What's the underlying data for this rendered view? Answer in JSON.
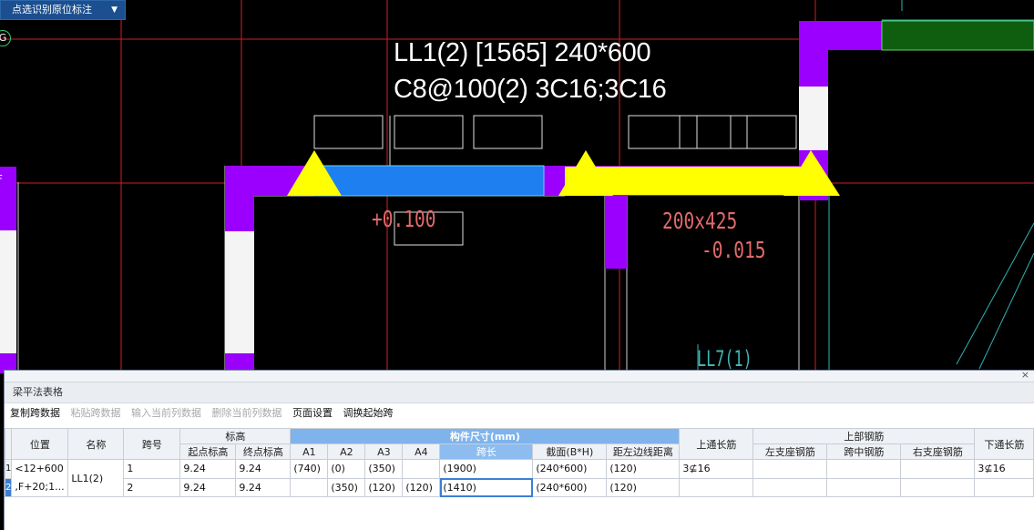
{
  "mode_dropdown": {
    "label": "点选识别原位标注",
    "arrow": "▼"
  },
  "markers": {
    "g": "G",
    "f": "F"
  },
  "beam_label": {
    "line1": "LL1(2) [1565] 240*600",
    "line2": "C8@100(2) 3C16;3C16"
  },
  "cad_texts": {
    "elevation": "+0.100",
    "section": "200x425",
    "offset": "-0.015",
    "beam_ref": "LL7(1)"
  },
  "colors": {
    "column": "#9b00ff",
    "beam_selected": "#1e7ff0",
    "highlight": "#ffff00",
    "grid_line": "#d01f1f",
    "teal_line": "#2fb3b3"
  },
  "panel": {
    "title": "梁平法表格",
    "close": "×",
    "toolbar": [
      {
        "label": "复制跨数据",
        "enabled": true
      },
      {
        "label": "粘贴跨数据",
        "enabled": false
      },
      {
        "label": "输入当前列数据",
        "enabled": false
      },
      {
        "label": "删除当前列数据",
        "enabled": false
      },
      {
        "label": "页面设置",
        "enabled": true
      },
      {
        "label": "调换起始跨",
        "enabled": true
      }
    ],
    "headers": {
      "position": "位置",
      "name": "名称",
      "span_no": "跨号",
      "elevation_group": "标高",
      "start_elev": "起点标高",
      "end_elev": "终点标高",
      "dims_group": "构件尺寸(mm)",
      "a1": "A1",
      "a2": "A2",
      "a3": "A3",
      "a4": "A4",
      "span_len": "跨长",
      "section": "截面(B*H)",
      "edge_dist": "距左边线距离",
      "top_through": "上通长筋",
      "top_rebar_group": "上部钢筋",
      "left_support": "左支座钢筋",
      "mid_span": "跨中钢筋",
      "right_support": "右支座钢筋",
      "bottom_through": "下通长筋"
    },
    "rows": [
      {
        "rn": "1",
        "position": "<12+600",
        "name": "LL1(2)",
        "span": "1",
        "start": "9.24",
        "end": "9.24",
        "a1": "(740)",
        "a2": "(0)",
        "a3": "(350)",
        "a4": "",
        "span_len": "(1900)",
        "section": "(240*600)",
        "edge": "(120)",
        "top_through": "3⊈16",
        "left": "",
        "mid": "",
        "right": "",
        "bottom": "3⊈16"
      },
      {
        "rn": "2",
        "position": ",F+20;1...",
        "name": "",
        "span": "2",
        "start": "9.24",
        "end": "9.24",
        "a1": "",
        "a2": "(350)",
        "a3": "(120)",
        "a4": "(120)",
        "span_len": "(1410)",
        "section": "(240*600)",
        "edge": "(120)",
        "top_through": "",
        "left": "",
        "mid": "",
        "right": "",
        "bottom": ""
      }
    ]
  }
}
